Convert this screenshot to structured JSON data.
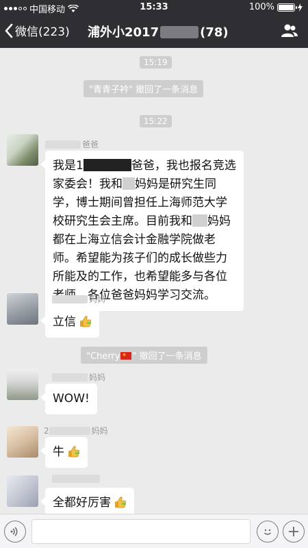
{
  "status_bar": {
    "carrier": "中国移动",
    "time": "15:33",
    "battery": "100%",
    "battery_level": 1.0
  },
  "nav": {
    "back_label": "微信(223)",
    "title_prefix": "浦外小2017",
    "title_suffix": "(78)"
  },
  "messages": {
    "time_1": "15:19",
    "recall_1": "\"青青子衿\" 撤回了一条消息",
    "time_2": "15:22",
    "msg1": {
      "sender_suffix": "爸爸",
      "line_a": "我是1",
      "line_b": "爸爸，我也报名竞选家委会！我和",
      "line_c": "妈妈是研究生同学，博士期间曾担任上海师范大学校研究生会主席。目前我和",
      "line_d": "妈妈都在上海立信会计金融学院做老师。希望能为孩子们的成长做些力所能及的工作，也希望能多与各位老师、各位爸爸妈妈学习交流。"
    },
    "msg2": {
      "sender_suffix": "妈妈",
      "text": "立信"
    },
    "recall_2_prefix": "\"Cherry",
    "recall_2_suffix": "\" 撤回了一条消息",
    "msg3": {
      "sender_suffix": "妈妈",
      "text": "WOW!"
    },
    "msg4": {
      "sender_prefix": "2",
      "sender_suffix": "妈妈",
      "text": "牛"
    },
    "msg5": {
      "text": "全都好厉害"
    }
  },
  "icons": {
    "back": "chevron-left-icon",
    "group": "group-people-icon",
    "voice": "voice-icon",
    "emoji": "emoji-icon",
    "plus": "plus-icon",
    "thumbs": "thumbs-up-icon",
    "wifi": "wifi-icon",
    "charging": "bolt-icon"
  },
  "colors": {
    "title_bar": "#2e2e33",
    "chat_background": "#ebebeb",
    "pill": "#cecece",
    "bubble": "#ffffff"
  }
}
